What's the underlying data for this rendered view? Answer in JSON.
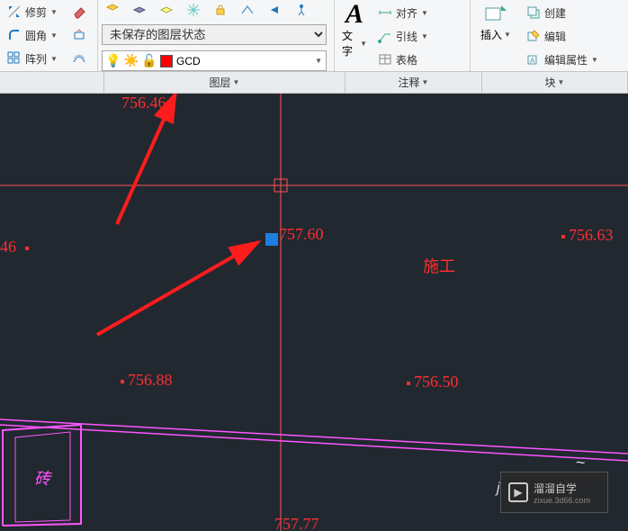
{
  "ribbon": {
    "modify": {
      "trim_label": "修剪",
      "fillet_label": "圆角",
      "array_label": "阵列"
    },
    "layer": {
      "state_value": "未保存的图层状态",
      "name": "GCD",
      "panel_label": "图层"
    },
    "annotation": {
      "text_label": "文字",
      "align_label": "对齐",
      "leader_label": "引线",
      "table_label": "表格",
      "panel_label": "注释"
    },
    "insert": {
      "label": "插入",
      "panel_label": "块",
      "create_label": "创建",
      "edit_label": "编辑",
      "editattr_label": "编辑属性"
    }
  },
  "drawing": {
    "pt_top": "756.46",
    "pt_left": "46",
    "pt_mid": "757.60",
    "pt_right": "756.63",
    "pt_bl": "756.88",
    "pt_br": "756.50",
    "pt_bottom": "757.77",
    "text_sg": "施工",
    "text_zhuan": "砖"
  },
  "watermark": {
    "line1": "溜溜自学",
    "line2": "zixue.3d66.com"
  }
}
